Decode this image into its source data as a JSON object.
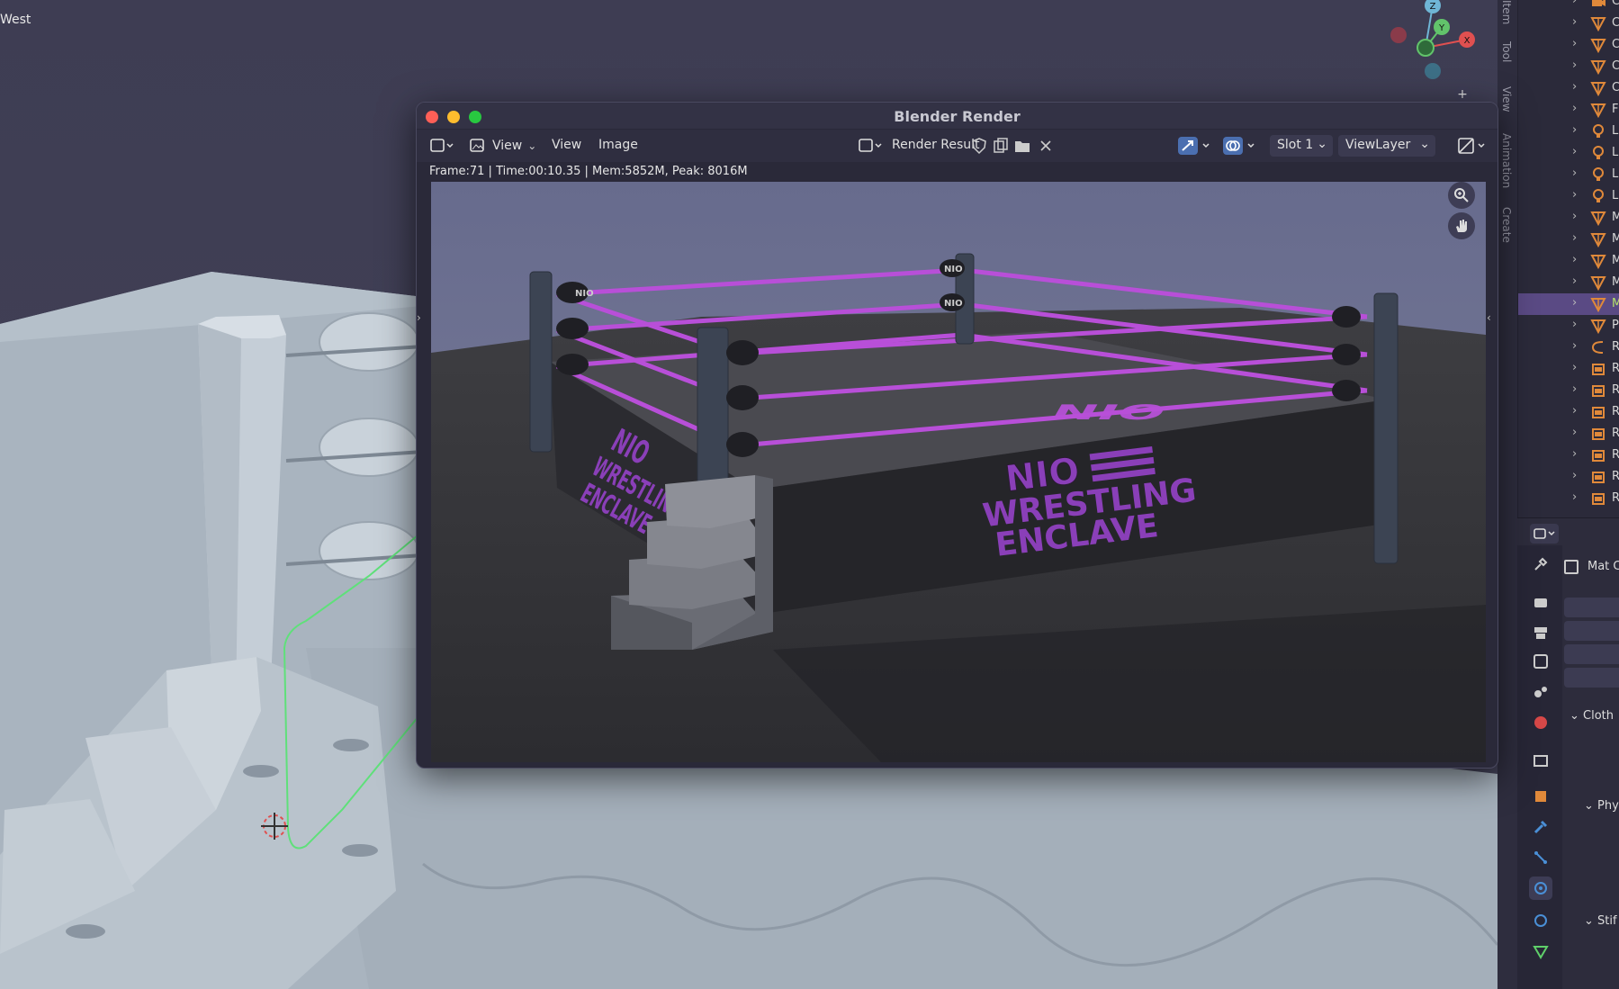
{
  "viewport": {
    "view_label": "West",
    "gizmo": {
      "z": "Z",
      "y": "Y",
      "x": "X"
    }
  },
  "side_tabs": [
    "Item",
    "Tool",
    "View",
    "Animation",
    "Create"
  ],
  "render_window": {
    "title": "Blender Render",
    "menu": {
      "view1": "View",
      "view2": "View",
      "image": "Image"
    },
    "image_name": "Render Result",
    "slot": "Slot 1",
    "view_layer": "ViewLayer",
    "stats": "Frame:71 | Time:00:10.35 | Mem:5852M, Peak: 8016M",
    "ring_branding": {
      "corner_pad": "NIO",
      "mat_logo": "NIO",
      "apron_line1": "NIO",
      "apron_line2": "WRESTLING",
      "apron_line3": "ENCLAVE"
    },
    "colors": {
      "rope": "#b84fd8",
      "apron_text": "#8a3fb8"
    }
  },
  "outliner": {
    "rows": [
      {
        "icon": "camera-icon",
        "text": "C"
      },
      {
        "icon": "mesh-icon",
        "text": "C"
      },
      {
        "icon": "mesh-icon",
        "text": "C"
      },
      {
        "icon": "mesh-icon",
        "text": "C"
      },
      {
        "icon": "mesh-icon",
        "text": "C"
      },
      {
        "icon": "mesh-icon",
        "text": "F"
      },
      {
        "icon": "light-icon",
        "text": "L"
      },
      {
        "icon": "light-icon",
        "text": "L"
      },
      {
        "icon": "light-icon",
        "text": "L"
      },
      {
        "icon": "light-icon",
        "text": "L"
      },
      {
        "icon": "mesh-icon",
        "text": "M"
      },
      {
        "icon": "mesh-icon",
        "text": "M"
      },
      {
        "icon": "mesh-icon",
        "text": "M"
      },
      {
        "icon": "mesh-icon",
        "text": "M"
      },
      {
        "icon": "mesh-icon",
        "text": "M",
        "selected": true
      },
      {
        "icon": "mesh-icon",
        "text": "P"
      },
      {
        "icon": "curve-icon",
        "text": "R"
      },
      {
        "icon": "collection-icon",
        "text": "R"
      },
      {
        "icon": "collection-icon",
        "text": "R"
      },
      {
        "icon": "collection-icon",
        "text": "R"
      },
      {
        "icon": "collection-icon",
        "text": "R"
      },
      {
        "icon": "collection-icon",
        "text": "R"
      },
      {
        "icon": "collection-icon",
        "text": "R"
      },
      {
        "icon": "collection-icon",
        "text": "R"
      }
    ]
  },
  "properties": {
    "material_label": "Mat C",
    "sections": {
      "cloth": "Cloth",
      "physics": "Phy",
      "stiffness": "Stif"
    }
  }
}
